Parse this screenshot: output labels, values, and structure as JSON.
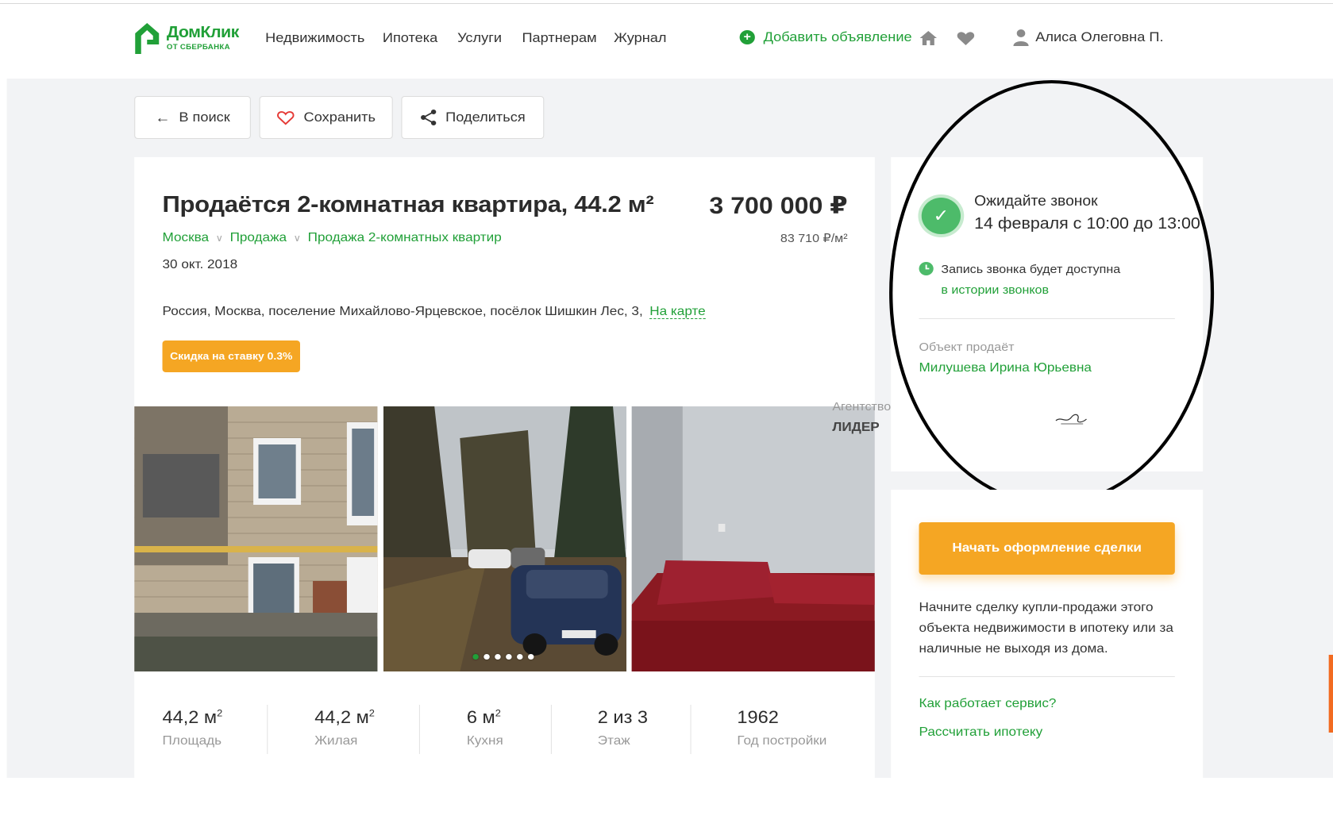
{
  "header": {
    "logo_title": "ДомКлик",
    "logo_subtitle": "ОТ СБЕРБАНКА",
    "nav": [
      "Недвижимость",
      "Ипотека",
      "Услуги",
      "Партнерам",
      "Журнал"
    ],
    "add_listing": "Добавить объявление",
    "user_name": "Алиса Олеговна П.",
    "brand_color": "#21a038"
  },
  "toolbar": {
    "back_label": "В поиск",
    "save_label": "Сохранить",
    "share_label": "Поделиться"
  },
  "listing": {
    "title": "Продаётся 2-комнатная квартира, 44.2 м²",
    "price": "3 700 000 ₽",
    "price_per_m2": "83 710 ₽/м²",
    "breadcrumbs": [
      "Москва",
      "Продажа",
      "Продажа 2-комнатных квартир"
    ],
    "date": "30 окт. 2018",
    "address": "Россия, Москва, поселение Михайлово-Ярцевское, посёлок Шишкин Лес, 3,",
    "map_link": "На карте",
    "discount_badge": "Скидка на ставку 0.3%",
    "agency_label": "Агентство",
    "agency_name": "ЛИДЕР",
    "gallery_dots": 6,
    "gallery_active_dot": 1
  },
  "stats": [
    {
      "value": "44,2 м",
      "sup": "2",
      "label": "Площадь"
    },
    {
      "value": "44,2 м",
      "sup": "2",
      "label": "Жилая"
    },
    {
      "value": "6 м",
      "sup": "2",
      "label": "Кухня"
    },
    {
      "value": "2 из 3",
      "sup": "",
      "label": "Этаж"
    },
    {
      "value": "1962",
      "sup": "",
      "label": "Год постройки"
    }
  ],
  "call": {
    "title": "Ожидайте звонок",
    "time": "14 февраля с 10:00 до 13:00",
    "record_text": "Запись звонка будет доступна",
    "record_link": "в истории звонков",
    "seller_label": "Объект продаёт",
    "seller_name": "Милушева Ирина Юрьевна"
  },
  "deal": {
    "button": "Начать оформление сделки",
    "description": "Начните сделку купли-продажи этого объекта недвижимости в ипотеку или за наличные не выходя из дома.",
    "link_how": "Как работает сервис?",
    "link_calc": "Рассчитать ипотеку",
    "accent_color": "#f5a623"
  }
}
